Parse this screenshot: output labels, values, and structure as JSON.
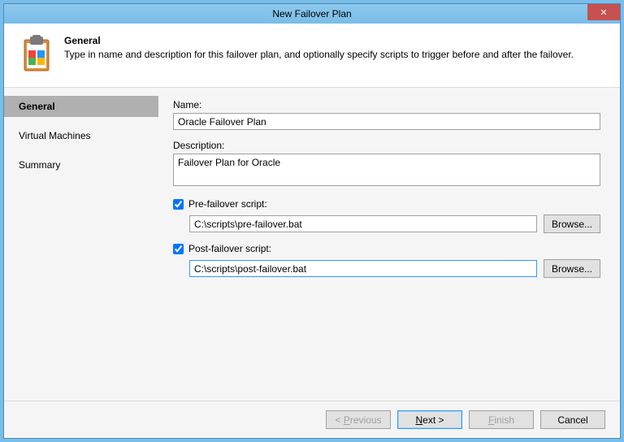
{
  "window": {
    "title": "New Failover Plan",
    "close": "✕"
  },
  "header": {
    "title": "General",
    "subtitle": "Type in name and description for this failover plan, and optionally specify scripts to trigger before and after the failover."
  },
  "sidebar": {
    "items": [
      {
        "label": "General",
        "active": true
      },
      {
        "label": "Virtual Machines",
        "active": false
      },
      {
        "label": "Summary",
        "active": false
      }
    ]
  },
  "form": {
    "name_label": "Name:",
    "name_value": "Oracle Failover Plan",
    "desc_label": "Description:",
    "desc_value": "Failover Plan for Oracle",
    "pre_label": "Pre-failover script:",
    "pre_checked": true,
    "pre_value": "C:\\scripts\\pre-failover.bat",
    "post_label": "Post-failover script:",
    "post_checked": true,
    "post_value": "C:\\scripts\\post-failover.bat",
    "browse_label": "Browse..."
  },
  "footer": {
    "previous": "< Previous",
    "next": "Next >",
    "finish": "Finish",
    "cancel": "Cancel"
  }
}
